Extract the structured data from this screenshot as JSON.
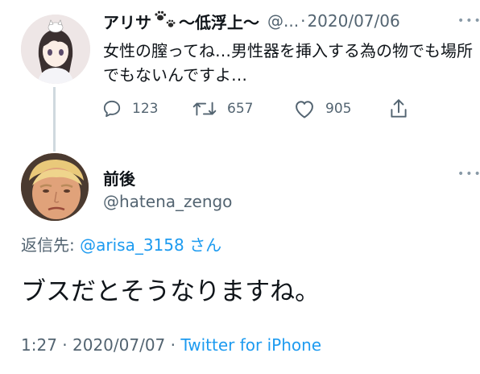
{
  "parent_tweet": {
    "name": "アリサ",
    "name_suffix": "〜低浮上〜",
    "handle": "@...",
    "separator": "·",
    "date": "2020/07/06",
    "more": "•••",
    "text": "女性の膣ってね…男性器を挿入する為の物でも場所でもないんですよ…",
    "actions": {
      "reply_icon": "reply-icon",
      "reply_count": "123",
      "retweet_icon": "retweet-icon",
      "retweet_count": "657",
      "like_icon": "heart-icon",
      "like_count": "905",
      "share_icon": "share-icon"
    }
  },
  "reply_tweet": {
    "name": "前後",
    "handle": "@hatena_zengo",
    "more": "•••",
    "replying_prefix": "返信先: ",
    "replying_to": "@arisa_3158",
    "replying_suffix": " さん",
    "text": "ブスだとそうなりますね。",
    "time": "1:27",
    "sep1": " · ",
    "date": "2020/07/07",
    "sep2": " · ",
    "source": "Twitter for iPhone"
  },
  "colors": {
    "link": "#1d9bf0",
    "secondary": "#536471",
    "primary": "#0f1419",
    "thread_line": "#cfd9de"
  }
}
